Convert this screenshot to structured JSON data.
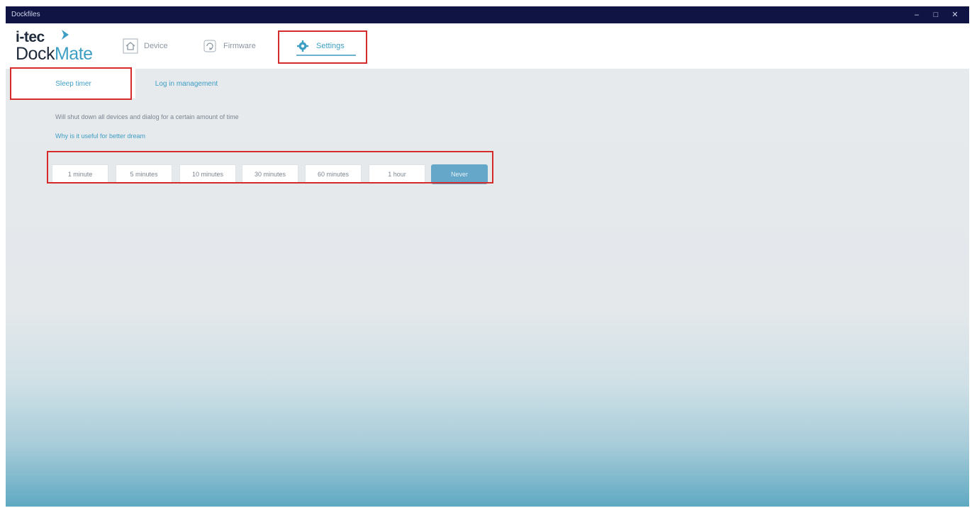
{
  "window": {
    "title": "Dockfiles",
    "controls": [
      "–",
      "□",
      "✕"
    ]
  },
  "logo": {
    "line1": "i-tec",
    "line2_a": "Dock",
    "line2_b": "Mate",
    "brand_color": "#3f9ec4"
  },
  "nav": [
    {
      "label": "Device",
      "icon": "house-icon"
    },
    {
      "label": "Firmware",
      "icon": "refresh-icon"
    },
    {
      "label": "Settings",
      "icon": "gear-icon",
      "active": true
    }
  ],
  "subtabs": [
    {
      "label": "Sleep timer",
      "active": true
    },
    {
      "label": "Log in management",
      "active": false
    }
  ],
  "settings": {
    "description": "Will shut down all devices and dialog for a certain amount of time",
    "link": "Why is it useful for better dream",
    "options": [
      {
        "label": "1 minute",
        "selected": false
      },
      {
        "label": "5 minutes",
        "selected": false
      },
      {
        "label": "10 minutes",
        "selected": false
      },
      {
        "label": "30 minutes",
        "selected": false
      },
      {
        "label": "60 minutes",
        "selected": false
      },
      {
        "label": "1 hour",
        "selected": false
      },
      {
        "label": "Never",
        "selected": true
      }
    ]
  },
  "colors": {
    "titlebar": "#0f1445",
    "accent": "#3f9ec4",
    "highlight": "#d62b2b"
  }
}
